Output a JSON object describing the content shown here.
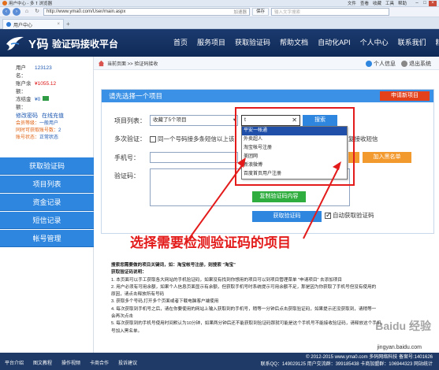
{
  "browser": {
    "window_title": "用户中心 - 多 ٱ 浏览器",
    "menu": [
      "文件",
      "查看",
      "收藏",
      "工具",
      "帮助"
    ],
    "url": "http://www.yma0.com/User/main.aspx",
    "url_addon": "加速器",
    "favorite_label": "保存",
    "search_placeholder": "输入文字搜索",
    "tab_label": "用户中心"
  },
  "header": {
    "brand_name": "Y码",
    "brand_sub": "验证码接收平台",
    "nav": [
      "首页",
      "服务项目",
      "获取验证码",
      "帮助文档",
      "自动化API",
      "个人中心",
      "联系我们",
      "精品推"
    ]
  },
  "account": {
    "username_label": "用户名：",
    "username": "123123",
    "balance_label": "账户余额：",
    "balance": "¥1055.12",
    "frozen_label": "冻结金额：",
    "frozen": "¥0",
    "change_pwd": "修改密码",
    "recharge": "在线充值",
    "level_label": "会员等级：",
    "level": "一般用户",
    "concurrent_label": "同时可获取账号数：",
    "concurrent": "2",
    "status_label": "账号状态：",
    "status": "正常状态"
  },
  "sidebar": {
    "items": [
      "获取验证码",
      "项目列表",
      "资金记录",
      "短信记录",
      "帐号管理"
    ]
  },
  "breadcrumb": "当前页面 >> 验证码接收",
  "user_tools": {
    "info": "个人信息",
    "logout": "退出系统"
  },
  "panel": {
    "title": "请先选择一个项目",
    "new_project": "申请新项目",
    "project_list_label": "项目列表：",
    "project_select": "收藏了5个项目",
    "project_input": "t",
    "search": "搜索",
    "dropdown": [
      "平安一帐通",
      "外卖超人",
      "淘宝帐号注册",
      "美团网",
      "新浪微博",
      "百度首页用户注册"
    ],
    "multi_label": "多次验证：",
    "multi_text": "同一个号码接多条短信以上该",
    "multi_tail": "复接收短信",
    "phone_label": "手机号：",
    "blacklist": "加入黑名单",
    "code_label": "验证码：",
    "copy_code": "复制验证码内容",
    "get_code": "获取验证码",
    "auto_get": "自动获取验证码"
  },
  "annotation": {
    "caption": "选择需要检测验证码的项目"
  },
  "help": {
    "line0": "搜索您需要做的项目关键词，如：淘宝帐号注册，则搜索 \"淘宝\"",
    "title": "获取验证码说明：",
    "lines": [
      "1. 本页面可以手工获取各大网站的手机验证码，如果没有找到你想用的项目可以到项目管理菜单 \"申请项目\" 去添加项目",
      "2. 用户必须有可用余额，如果个人信息页面显示有余额，但获取手机号时系统提示可用余额不足，那是因为你获取了手机号但没有使用的",
      "原因，请点击释放所有号码",
      "3. 获取多个号码,打开多个页面或者下载电脑客户端使用",
      "4. 每次获取到手机号之后，请在你要使用的网站上输入获取到的手机号，稍等一分钟后点击获取验证码，如果提示还没获取到，请稍等一",
      "会再次点击",
      "5. 每次获取到的手机号使用时间默认为10分钟，如果两分钟后还不能获取到验证码那就可能是这个手机号不能接收验证码，请释放这个手机",
      "号加入黑名单。"
    ]
  },
  "footer": {
    "links": [
      "平台介绍",
      "图文教程",
      "操作视频",
      "卡商合作",
      "投诉建议"
    ],
    "copyright": "© 2012-2015 www.yma0.com 多码网络科技 备案号:1401626",
    "contact": "联系QQ：149029125 用户交流群：399185438 卡商加盟群：106944323 网站统计",
    "watermark": "Baidu 经验",
    "watermark_url": "jingyan.baidu.com"
  },
  "colors": {
    "header_bg": "#1b3a6e",
    "accent_blue": "#2e86df",
    "annotation_red": "#e31b1b",
    "new_project_red": "#e3411c",
    "orange": "#f39a2f",
    "green": "#2fae3f"
  }
}
